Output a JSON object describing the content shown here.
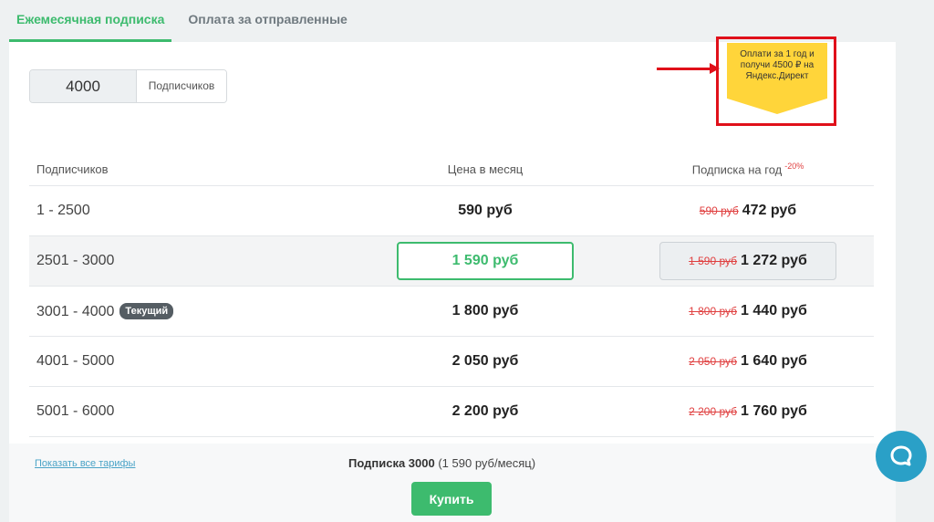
{
  "tabs": [
    {
      "label": "Ежемесячная подписка",
      "active": true
    },
    {
      "label": "Оплата за отправленные",
      "active": false
    }
  ],
  "subscribers_input": {
    "value": "4000",
    "unit": "Подписчиков"
  },
  "promo": {
    "text": "Оплати за 1 год и получи 4500 ₽ на Яндекс.Директ"
  },
  "table": {
    "headers": {
      "subscribers": "Подписчиков",
      "monthly": "Цена в месяц",
      "yearly": "Подписка на год",
      "yearly_discount": "-20%"
    },
    "current_badge": "Текущий",
    "rows": [
      {
        "range": "1 - 2500",
        "monthly": "590 руб",
        "old_price": "590 руб",
        "yearly": "472 руб"
      },
      {
        "range": "2501 - 3000",
        "monthly": "1 590 руб",
        "old_price": "1 590 руб",
        "yearly": "1 272 руб"
      },
      {
        "range": "3001 - 4000",
        "monthly": "1 800 руб",
        "old_price": "1 800 руб",
        "yearly": "1 440 руб"
      },
      {
        "range": "4001 - 5000",
        "monthly": "2 050 руб",
        "old_price": "2 050 руб",
        "yearly": "1 640 руб"
      },
      {
        "range": "5001 - 6000",
        "monthly": "2 200 руб",
        "old_price": "2 200 руб",
        "yearly": "1 760 руб"
      }
    ]
  },
  "footer": {
    "show_all": "Показать все тарифы",
    "summary_bold": "Подписка 3000",
    "summary_rest": "(1 590 руб/месяц)",
    "buy_label": "Купить"
  },
  "colors": {
    "accent": "#3dbb6e",
    "promo": "#ffd53a",
    "highlight": "#e0101a",
    "chat": "#2aa0c7"
  },
  "icons": {
    "chat": "chat-bubble-icon"
  }
}
